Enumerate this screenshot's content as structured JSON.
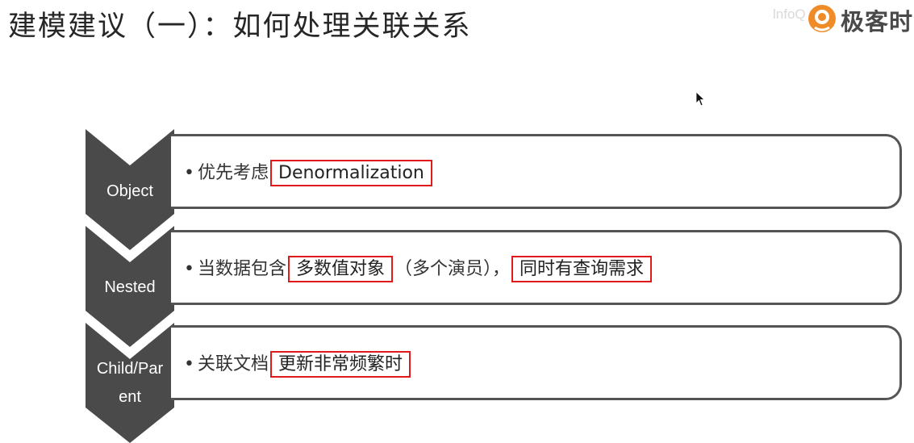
{
  "title": "建模建议（一）：如何处理关联关系",
  "logo": {
    "text": "极客时",
    "watermark": "lnfoQ"
  },
  "rows": [
    {
      "label": "Object",
      "text_parts": [
        {
          "text": "优先考虑",
          "highlight": false
        },
        {
          "text": "Denormalization",
          "highlight": true
        }
      ]
    },
    {
      "label": "Nested",
      "text_parts": [
        {
          "text": "当数据包含",
          "highlight": false
        },
        {
          "text": "多数值对象",
          "highlight": true
        },
        {
          "text": "（多个演员），",
          "highlight": false
        },
        {
          "text": "同时有查询需求",
          "highlight": true
        }
      ]
    },
    {
      "label_line1": "Child/Par",
      "label_line2": "ent",
      "text_parts": [
        {
          "text": "关联文档",
          "highlight": false
        },
        {
          "text": "更新非常频繁时",
          "highlight": true
        }
      ]
    }
  ],
  "colors": {
    "chevron": "#4a4a4a",
    "highlight_border": "#e0191b",
    "logo_orange": "#f08c28"
  },
  "icons": [
    "logo-mark-icon",
    "mouse-cursor-icon",
    "chevron-arrow-icon"
  ]
}
